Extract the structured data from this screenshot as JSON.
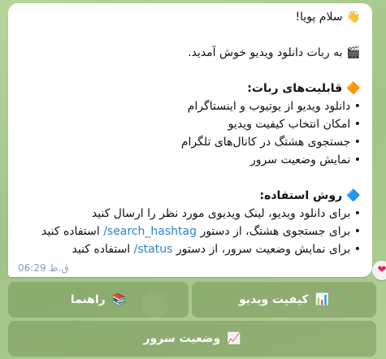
{
  "message": {
    "greeting_emoji": "👋",
    "greeting": "سلام پویا!",
    "welcome_emoji": "🎬",
    "welcome": "به ربات دانلود ویدیو خوش آمدید.",
    "features_emoji": "🔶",
    "features_title": "قابلیت‌های ربات:",
    "features": [
      "• دانلود ویدیو از یوتیوب و اینستاگرام",
      "• امکان انتخاب کیفیت ویدیو",
      "• جستجوی هشتگ در کانال‌های تلگرام",
      "• نمایش وضعیت سرور"
    ],
    "usage_emoji": "🔷",
    "usage_title": "روش استفاده:",
    "usage1": "• برای دانلود ویدیو، لینک ویدیوی مورد نظر را ارسال کنید",
    "usage2_pre": "• برای جستجوی هشتگ، از دستور",
    "usage2_cmd": "/search_hashtag",
    "usage2_post": "استفاده کنید",
    "usage3_pre": "• برای نمایش وضعیت سرور، از دستور",
    "usage3_cmd": "/status",
    "usage3_post": "استفاده کنید",
    "time": "06:29 ق.ظ",
    "reaction": "❤"
  },
  "keyboard": {
    "video_quality_icon": "📊",
    "video_quality_label": "کیفیت ویدیو",
    "guide_icon": "📚",
    "guide_label": "راهنما",
    "server_status_icon": "📈",
    "server_status_label": "وضعیت سرور"
  },
  "colors": {
    "link": "#2a84d0",
    "bubble": "#ffffff",
    "background": "#a9c98d",
    "keyboard_button": "#7f9a63"
  }
}
